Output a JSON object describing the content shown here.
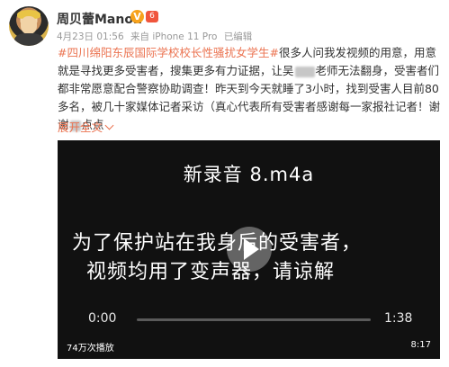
{
  "user": {
    "name": "周贝蕾Manon",
    "verified_badge": "V",
    "level_badge": "6"
  },
  "meta": {
    "date": "4月23日 01:56",
    "source": "来自 iPhone 11 Pro",
    "edited": "已编辑"
  },
  "post": {
    "hashtag": "#四川绵阳东辰国际学校校长性骚扰女学生#",
    "text_a": "很多人问我发视频的用意，用意就是寻找更多受害者，搜集更多有力证据，让吴",
    "text_b": "老师无法翻身，受害者们都非常愿意配合警察协助调查！昨天到今天就睡了3小时，找到受害人目前80多名，被几十家媒体记者采访（真心代表所有受害者感谢每一家报社记者！谢谢",
    "text_c": "点点",
    "expand_label": "展开全文"
  },
  "video": {
    "filename": "新录音 8.m4a",
    "notice_line1": "为了保护站在我身后的受害者，",
    "notice_line2": "视频均用了变声器，请谅解",
    "time_current": "0:00",
    "time_total": "1:38",
    "play_count": "74万次播放",
    "duration": "8:17",
    "progress": 0
  },
  "colors": {
    "accent": "#eb7350",
    "video_bg": "#111111"
  },
  "icons": {
    "verified": "verified-badge-icon",
    "level": "level-badge-icon",
    "play": "play-icon",
    "expand": "chevron-down-icon",
    "redacted": "blur-redaction"
  }
}
